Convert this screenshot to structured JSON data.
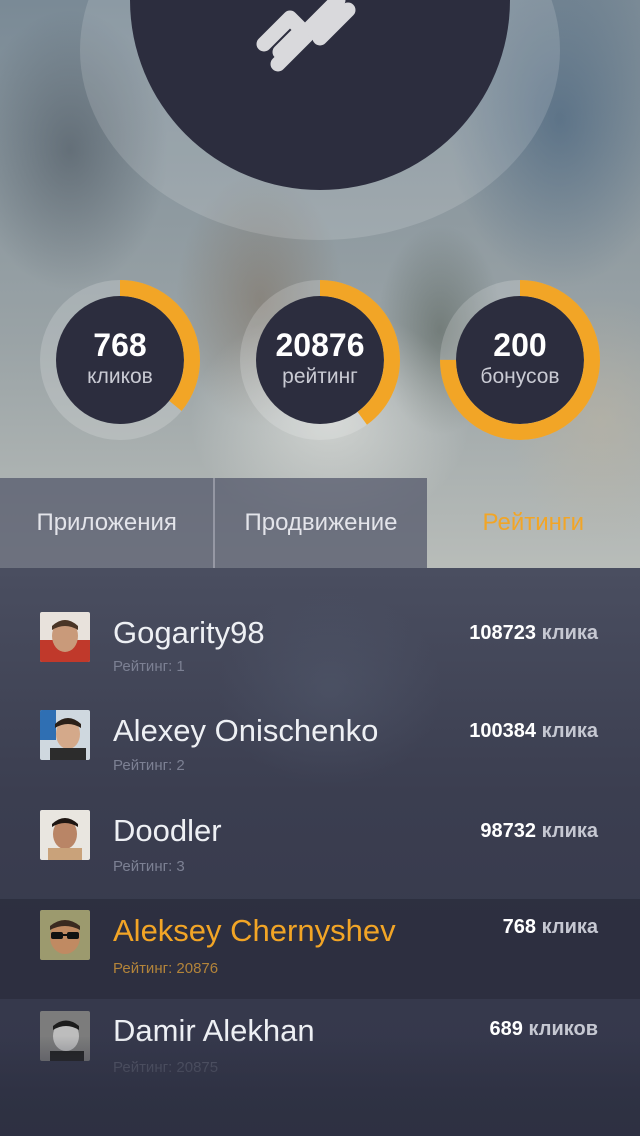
{
  "logo": {
    "icon": "link-icon"
  },
  "colors": {
    "accent": "#f2a526",
    "dark": "#2c2d3e",
    "text": "#eef0f4"
  },
  "stats": [
    {
      "value": "768",
      "label": "кликов",
      "progress": 0.36
    },
    {
      "value": "20876",
      "label": "рейтинг",
      "progress": 0.4
    },
    {
      "value": "200",
      "label": "бонусов",
      "progress": 0.75
    }
  ],
  "tabs": [
    {
      "label": "Приложения"
    },
    {
      "label": "Продвижение"
    },
    {
      "label": "Рейтинги"
    }
  ],
  "active_tab": "Рейтинги",
  "leaderboard": [
    {
      "name": "Gogarity98",
      "rank": "Рейтинг: 1",
      "clicks": "108723",
      "unit": "клика"
    },
    {
      "name": "Alexey Onischenko",
      "rank": "Рейтинг: 2",
      "clicks": "100384",
      "unit": "клика"
    },
    {
      "name": "Doodler",
      "rank": "Рейтинг: 3",
      "clicks": "98732",
      "unit": "клика"
    },
    {
      "name": "Aleksey Chernyshev",
      "rank": "Рейтинг: 20876",
      "clicks": "768",
      "unit": "клика"
    },
    {
      "name": "Damir Alekhan",
      "rank": "Рейтинг: 20875",
      "clicks": "689",
      "unit": "кликов"
    }
  ]
}
